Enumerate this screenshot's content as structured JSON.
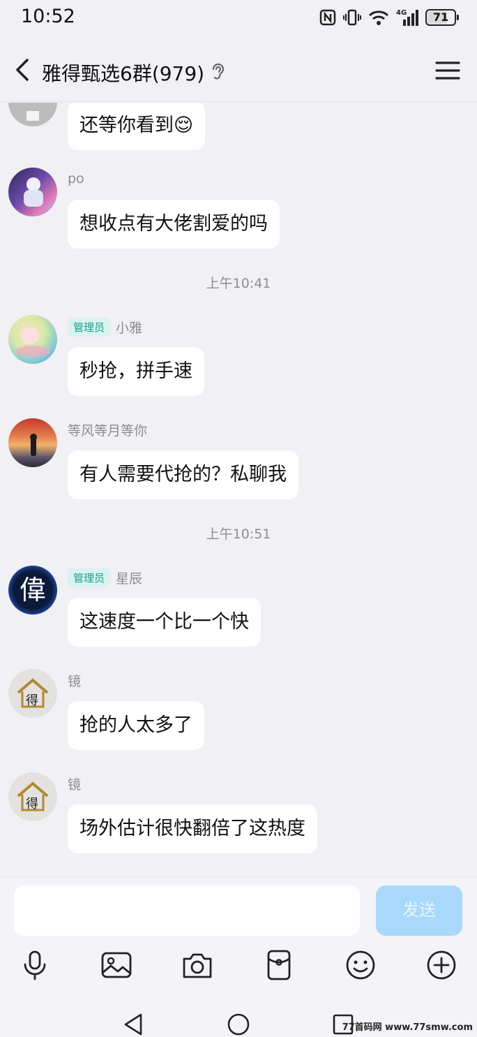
{
  "status": {
    "time": "10:52",
    "battery": "71",
    "network": "4G"
  },
  "header": {
    "title": "雅得甄选6群(979)"
  },
  "messages": [
    {
      "text": "还等你看到😌"
    },
    {
      "sender": "po",
      "text": "想收点有大佬割爱的吗"
    },
    {
      "sender": "小雅",
      "badge": "管理员",
      "text": "秒抢，拼手速"
    },
    {
      "sender": "等风等月等你",
      "text": "有人需要代抢的？私聊我"
    },
    {
      "sender": "星辰",
      "badge": "管理员",
      "text": "这速度一个比一个快"
    },
    {
      "sender": "镜",
      "text": "抢的人太多了"
    },
    {
      "sender": "镜",
      "text": "场外估计很快翻倍了这热度"
    }
  ],
  "timestamps": [
    "上午10:41",
    "上午10:51"
  ],
  "avatars": {
    "star_char": "偉",
    "house_char": "得"
  },
  "input": {
    "placeholder": "",
    "send_label": "发送"
  },
  "toolbar": [
    "mic-icon",
    "image-icon",
    "camera-icon",
    "red-packet-icon",
    "emoji-icon",
    "plus-icon"
  ],
  "watermark": "77首码网 www.77smw.com"
}
